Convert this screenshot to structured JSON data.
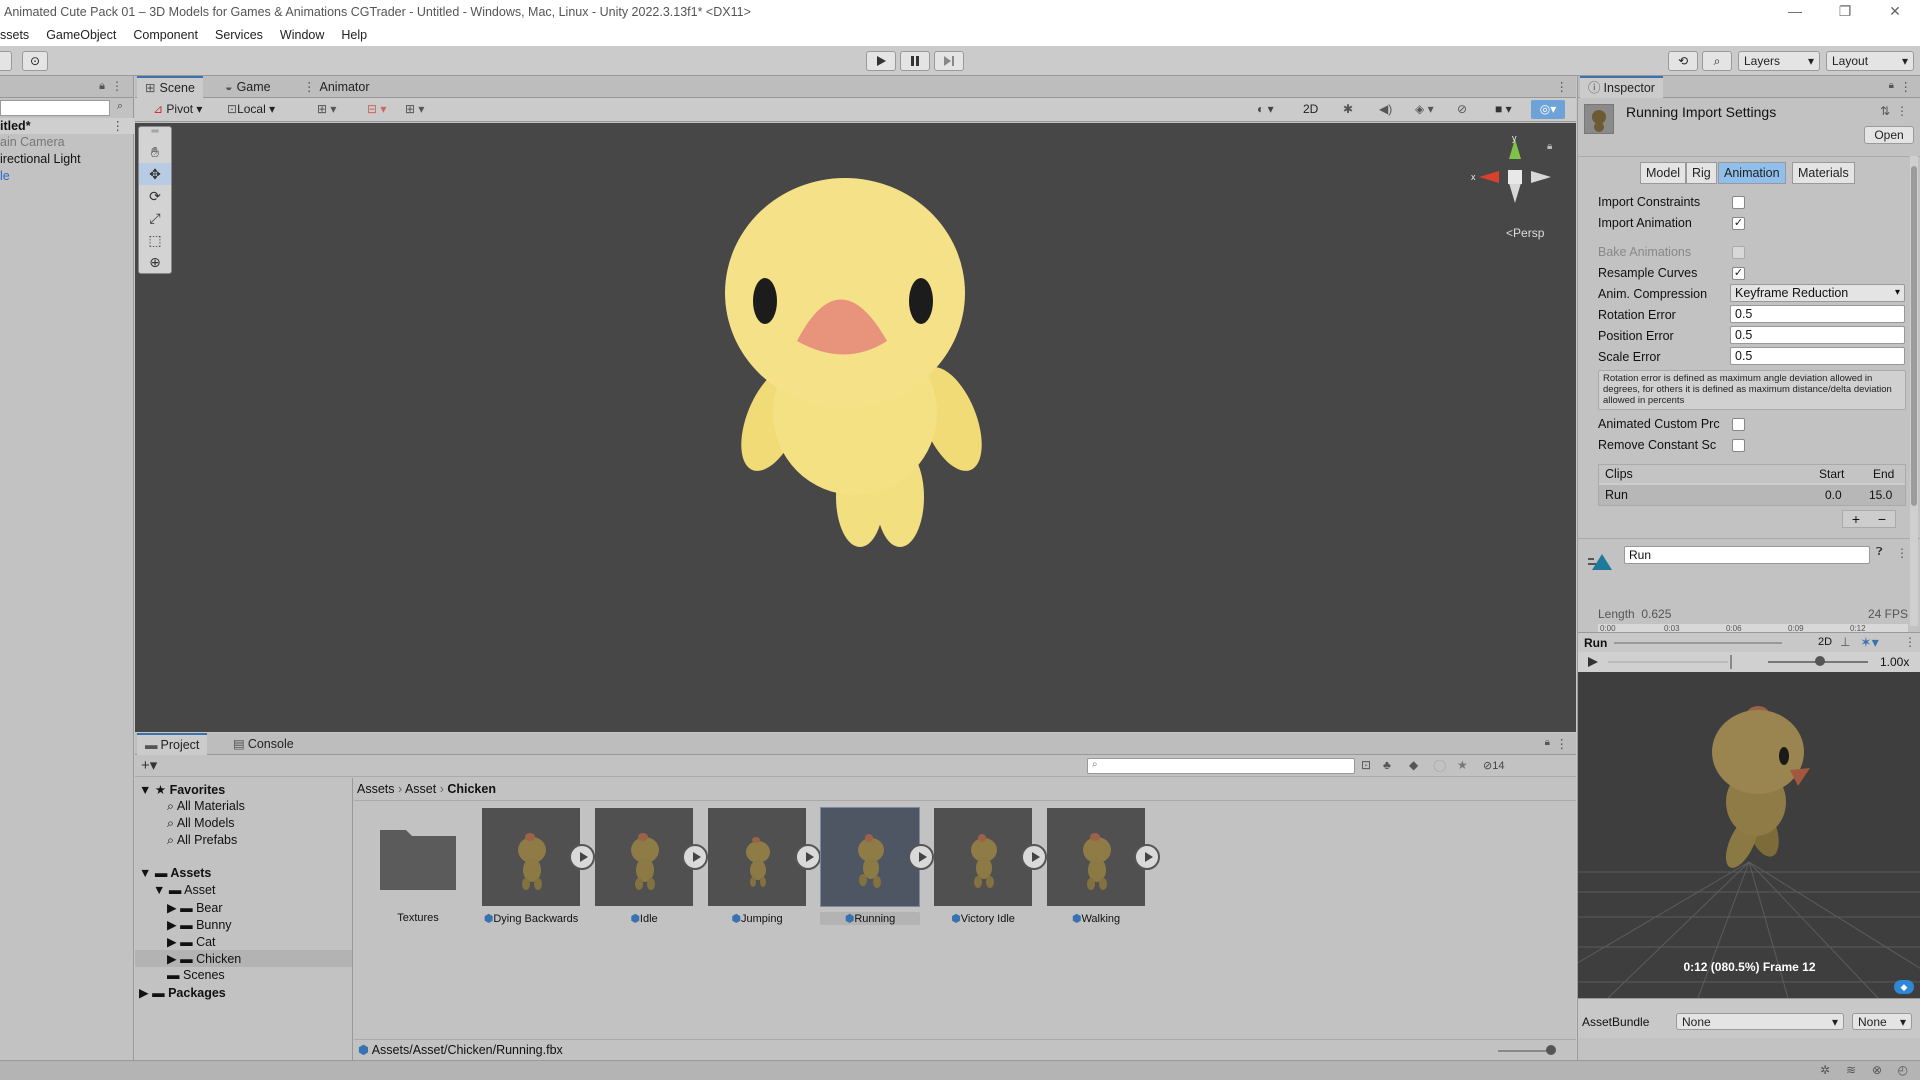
{
  "window": {
    "title": "Animated Cute Pack 01 – 3D Models for Games & Animations  CGTrader - Untitled - Windows, Mac, Linux - Unity 2022.3.13f1* <DX11>",
    "minimize": "—",
    "maximize": "❐",
    "close": "✕"
  },
  "menu": [
    "ssets",
    "GameObject",
    "Component",
    "Services",
    "Window",
    "Help"
  ],
  "toolbar": {
    "layers_label": "Layers",
    "layout_label": "Layout"
  },
  "hierarchy": {
    "scene_name": "itled*",
    "items": [
      "ain Camera",
      "irectional Light",
      "le"
    ]
  },
  "scene_tabs": [
    "Scene",
    "Game",
    "Animator"
  ],
  "scene_toolbar": {
    "pivot": "Pivot",
    "local": "Local",
    "mode_2d": "2D",
    "persp_label": "Persp"
  },
  "inspector": {
    "tab": "Inspector",
    "title": "Running Import Settings",
    "open_button": "Open",
    "subtabs": [
      "Model",
      "Rig",
      "Animation",
      "Materials"
    ],
    "active_subtab": "Animation",
    "rows": {
      "import_constraints": "Import Constraints",
      "import_animation": "Import Animation",
      "bake_animations": "Bake Animations",
      "resample_curves": "Resample Curves",
      "anim_compression": "Anim. Compression",
      "anim_compression_value": "Keyframe Reduction",
      "rotation_error": "Rotation Error",
      "rotation_error_value": "0.5",
      "position_error": "Position Error",
      "position_error_value": "0.5",
      "scale_error": "Scale Error",
      "scale_error_value": "0.5",
      "help_text": "Rotation error is defined as maximum angle deviation allowed in degrees, for others it is defined as maximum distance/delta deviation allowed in percents",
      "animated_custom": "Animated Custom Prc",
      "remove_constant": "Remove Constant Sc"
    },
    "checks": {
      "import_constraints": false,
      "import_animation": true,
      "bake_animations": false,
      "resample_curves": true,
      "animated_custom": false,
      "remove_constant": false
    },
    "clips": {
      "header": "Clips",
      "start_header": "Start",
      "end_header": "End",
      "rows": [
        {
          "name": "Run",
          "start": "0.0",
          "end": "15.0"
        }
      ],
      "add": "+",
      "remove": "−"
    },
    "clip_name": "Run",
    "length_label": "Length",
    "length_value": "0.625",
    "fps": "24 FPS",
    "timeline_ticks": [
      "0:00",
      "0:03",
      "0:06",
      "0:09",
      "0:12"
    ],
    "preview": {
      "clip": "Run",
      "mode_2d": "2D",
      "speed": "1.00x",
      "frame_info": "0:12 (080.5%) Frame 12"
    },
    "asset_bundle_label": "AssetBundle",
    "asset_bundle_value": "None",
    "asset_bundle_variant": "None"
  },
  "project": {
    "tabs": [
      "Project",
      "Console"
    ],
    "count_badge": "14",
    "favorites": {
      "label": "Favorites",
      "items": [
        "All Materials",
        "All Models",
        "All Prefabs"
      ]
    },
    "tree": {
      "assets": "Assets",
      "asset": "Asset",
      "children": [
        "Bear",
        "Bunny",
        "Cat",
        "Chicken"
      ],
      "scenes": "Scenes",
      "packages": "Packages"
    },
    "breadcrumb": [
      "Assets",
      "Asset",
      "Chicken"
    ],
    "items": [
      {
        "name": "Textures",
        "type": "folder"
      },
      {
        "name": "Dying Backwards",
        "type": "model"
      },
      {
        "name": "Idle",
        "type": "model"
      },
      {
        "name": "Jumping",
        "type": "model"
      },
      {
        "name": "Running",
        "type": "model"
      },
      {
        "name": "Victory Idle",
        "type": "model"
      },
      {
        "name": "Walking",
        "type": "model"
      }
    ],
    "selected_item": "Running",
    "path": "Assets/Asset/Chicken/Running.fbx"
  },
  "colors": {
    "accent": "#3a72b0",
    "viewport_bg": "#474747",
    "chick_body": "#f2df7f",
    "chick_beak": "#e8937b",
    "selection": "#8fbfea"
  }
}
